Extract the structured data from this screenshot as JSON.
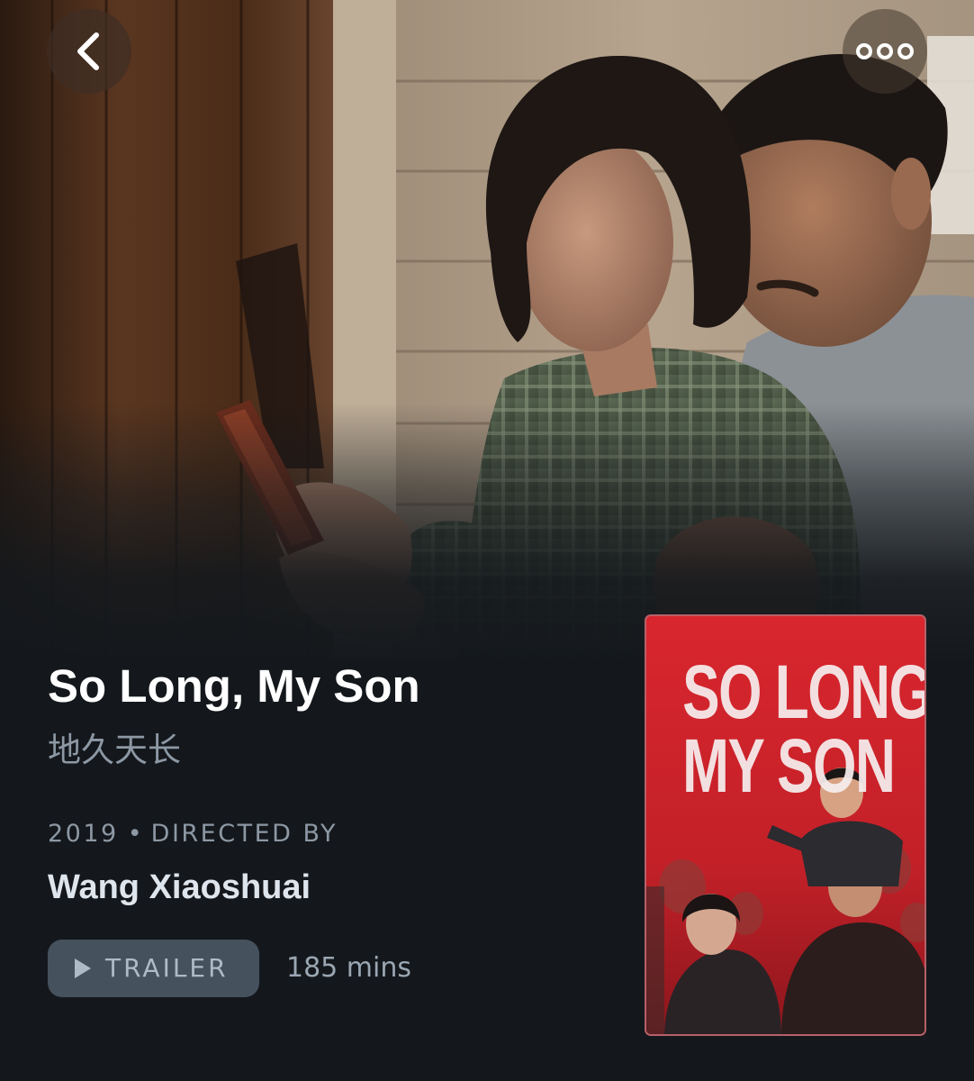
{
  "header": {
    "back_icon": "chevron-left-icon",
    "more_icon": "ellipsis-icon"
  },
  "film": {
    "title": "So Long, My Son",
    "original_title": "地久天长",
    "year": "2019",
    "separator": "•",
    "directed_by_label": "DIRECTED BY",
    "director": "Wang Xiaoshuai",
    "runtime": "185 mins"
  },
  "actions": {
    "trailer_label": "TRAILER",
    "trailer_icon": "play-icon"
  },
  "poster": {
    "title_line1": "SO LONG",
    "title_line2": "MY SON",
    "background_color": "#c8242c"
  },
  "colors": {
    "page_background": "#14181c",
    "title_text": "#ffffff",
    "muted_text": "#8d98a4",
    "director_text": "#dfe5ec",
    "trailer_button": "#45515d"
  }
}
